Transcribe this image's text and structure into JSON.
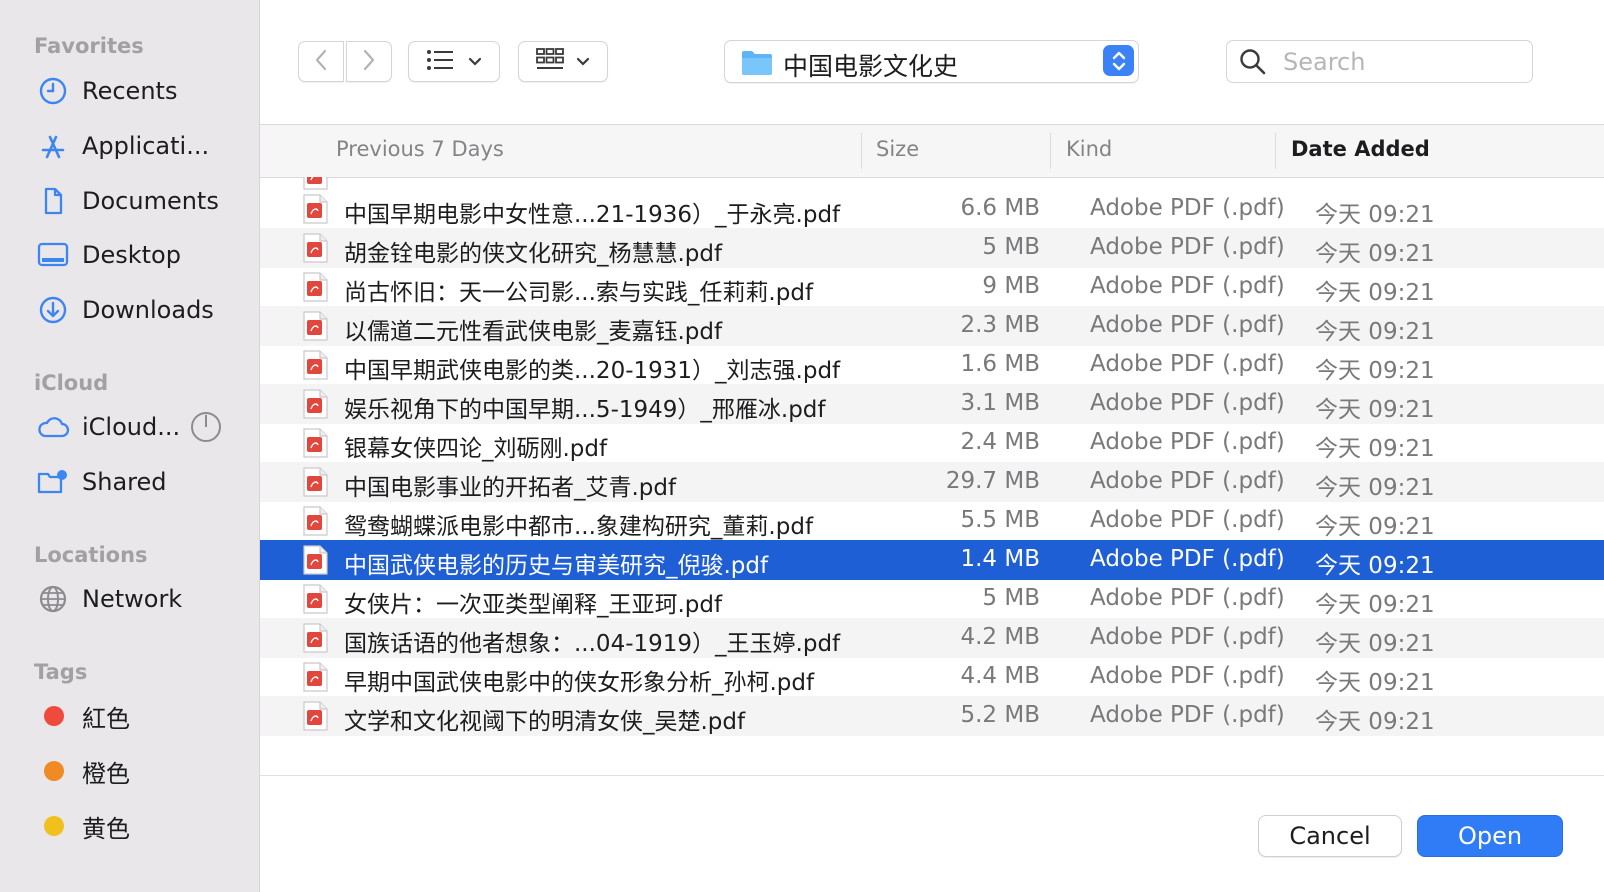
{
  "sidebar": {
    "favorites_heading": "Favorites",
    "favorites": [
      {
        "label": "Recents",
        "icon": "clock-icon"
      },
      {
        "label": "Applicati...",
        "icon": "applications-icon"
      },
      {
        "label": "Documents",
        "icon": "document-icon"
      },
      {
        "label": "Desktop",
        "icon": "desktop-icon"
      },
      {
        "label": "Downloads",
        "icon": "download-icon"
      }
    ],
    "icloud_heading": "iCloud",
    "icloud": [
      {
        "label": "iCloud...",
        "icon": "cloud-icon"
      },
      {
        "label": "Shared",
        "icon": "shared-folder-icon"
      }
    ],
    "locations_heading": "Locations",
    "locations": [
      {
        "label": "Network",
        "icon": "globe-icon"
      }
    ],
    "tags_heading": "Tags",
    "tags": [
      {
        "label": "紅色",
        "color": "#f04a3c"
      },
      {
        "label": "橙色",
        "color": "#f08a24"
      },
      {
        "label": "黄色",
        "color": "#f2c01e"
      }
    ]
  },
  "toolbar": {
    "path_label": "中国电影文化史",
    "search_placeholder": "Search"
  },
  "table": {
    "group_header": "Previous 7 Days",
    "col_size": "Size",
    "col_kind": "Kind",
    "col_date": "Date Added",
    "rows": [
      {
        "name": "中国早期电影中女性意...21-1936）_于永亮.pdf",
        "size": "6.6 MB",
        "kind": "Adobe PDF (.pdf)",
        "date": "今天 09:21"
      },
      {
        "name": "胡金铨电影的侠文化研究_杨慧慧.pdf",
        "size": "5 MB",
        "kind": "Adobe PDF (.pdf)",
        "date": "今天 09:21"
      },
      {
        "name": "尚古怀旧：天一公司影...索与实践_任莉莉.pdf",
        "size": "9 MB",
        "kind": "Adobe PDF (.pdf)",
        "date": "今天 09:21"
      },
      {
        "name": "以儒道二元性看武侠电影_麦嘉钰.pdf",
        "size": "2.3 MB",
        "kind": "Adobe PDF (.pdf)",
        "date": "今天 09:21"
      },
      {
        "name": "中国早期武侠电影的类...20-1931）_刘志强.pdf",
        "size": "1.6 MB",
        "kind": "Adobe PDF (.pdf)",
        "date": "今天 09:21"
      },
      {
        "name": "娱乐视角下的中国早期...5-1949）_邢雁冰.pdf",
        "size": "3.1 MB",
        "kind": "Adobe PDF (.pdf)",
        "date": "今天 09:21"
      },
      {
        "name": "银幕女侠四论_刘砺刚.pdf",
        "size": "2.4 MB",
        "kind": "Adobe PDF (.pdf)",
        "date": "今天 09:21"
      },
      {
        "name": "中国电影事业的开拓者_艾青.pdf",
        "size": "29.7 MB",
        "kind": "Adobe PDF (.pdf)",
        "date": "今天 09:21"
      },
      {
        "name": "鸳鸯蝴蝶派电影中都市...象建构研究_董莉.pdf",
        "size": "5.5 MB",
        "kind": "Adobe PDF (.pdf)",
        "date": "今天 09:21"
      },
      {
        "name": "中国武侠电影的历史与审美研究_倪骏.pdf",
        "size": "1.4 MB",
        "kind": "Adobe PDF (.pdf)",
        "date": "今天 09:21",
        "selected": true
      },
      {
        "name": "女侠片：一次亚类型阐释_王亚珂.pdf",
        "size": "5 MB",
        "kind": "Adobe PDF (.pdf)",
        "date": "今天 09:21"
      },
      {
        "name": "国族话语的他者想象：...04-1919）_王玉婷.pdf",
        "size": "4.2 MB",
        "kind": "Adobe PDF (.pdf)",
        "date": "今天 09:21"
      },
      {
        "name": "早期中国武侠电影中的侠女形象分析_孙柯.pdf",
        "size": "4.4 MB",
        "kind": "Adobe PDF (.pdf)",
        "date": "今天 09:21"
      },
      {
        "name": "文学和文化视阈下的明清女侠_吴楚.pdf",
        "size": "5.2 MB",
        "kind": "Adobe PDF (.pdf)",
        "date": "今天 09:21"
      }
    ]
  },
  "buttons": {
    "cancel": "Cancel",
    "open": "Open"
  },
  "colors": {
    "accent": "#2f7cf6",
    "selection": "#1f5fd6",
    "sidebar_icon": "#3d86f2"
  }
}
